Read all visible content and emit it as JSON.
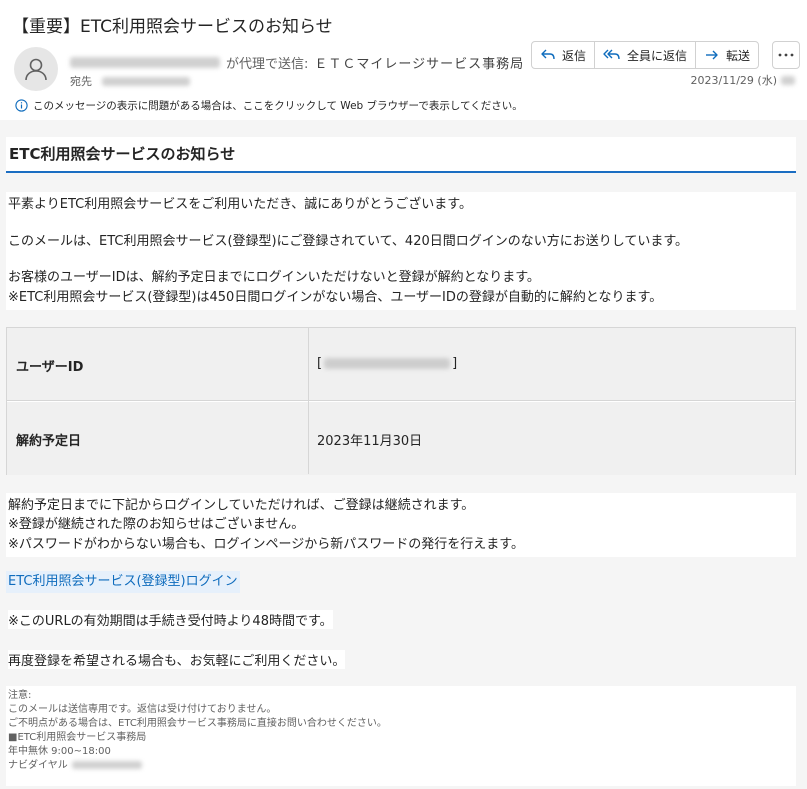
{
  "header": {
    "subject": "【重要】ETC利用照会サービスのお知らせ",
    "from_separator": "が代理で送信:",
    "from_name": "ＥＴＣマイレージサービス事務局",
    "to_label": "宛先",
    "date": "2023/11/29 (水)",
    "info_bar": "このメッセージの表示に問題がある場合は、ここをクリックして Web ブラウザーで表示してください。"
  },
  "actions": {
    "reply": "返信",
    "reply_all": "全員に返信",
    "forward": "転送"
  },
  "body": {
    "section_title": "ETC利用照会サービスのお知らせ",
    "para1": [
      "平素よりETC利用照会サービスをご利用いただき、誠にありがとうございます。",
      "このメールは、ETC利用照会サービス(登録型)にご登録されていて、420日間ログインのない方にお送りしています。",
      "お客様のユーザーIDは、解約予定日までにログインいただけないと登録が解約となります。",
      "※ETC利用照会サービス(登録型)は450日間ログインがない場合、ユーザーIDの登録が自動的に解約となります。"
    ],
    "table": {
      "row1_label": "ユーザーID",
      "row1_open": "[",
      "row1_close": "]",
      "row2_label": "解約予定日",
      "row2_value": "2023年11月30日"
    },
    "para2": [
      "解約予定日までに下記からログインしていただければ、ご登録は継続されます。",
      "※登録が継続された際のお知らせはございません。",
      "※パスワードがわからない場合も、ログインページから新パスワードの発行を行えます。"
    ],
    "login_link": "ETC利用照会サービス(登録型)ログイン",
    "url_validity": "※このURLの有効期間は手続き受付時より48時間です。",
    "re_register": "再度登録を希望される場合も、お気軽にご利用ください。",
    "notes": {
      "title": "注意:",
      "line1": "このメールは送信専用です。返信は受け付けておりません。",
      "line2": "ご不明点がある場合は、ETC利用照会サービス事務局に直接お問い合わせください。",
      "line3": "■ETC利用照会サービス事務局",
      "line4": "年中無休 9:00~18:00",
      "line5": "ナビダイヤル"
    }
  },
  "colors": {
    "accent": "#1a6dc2",
    "link": "#0f6cbd",
    "icon": "#0f6cbd"
  },
  "icons": {
    "avatar": "person-icon",
    "reply": "reply-arrow-icon",
    "reply_all": "reply-all-arrow-icon",
    "forward": "forward-arrow-icon",
    "more": "more-dots-icon",
    "info": "info-icon"
  }
}
